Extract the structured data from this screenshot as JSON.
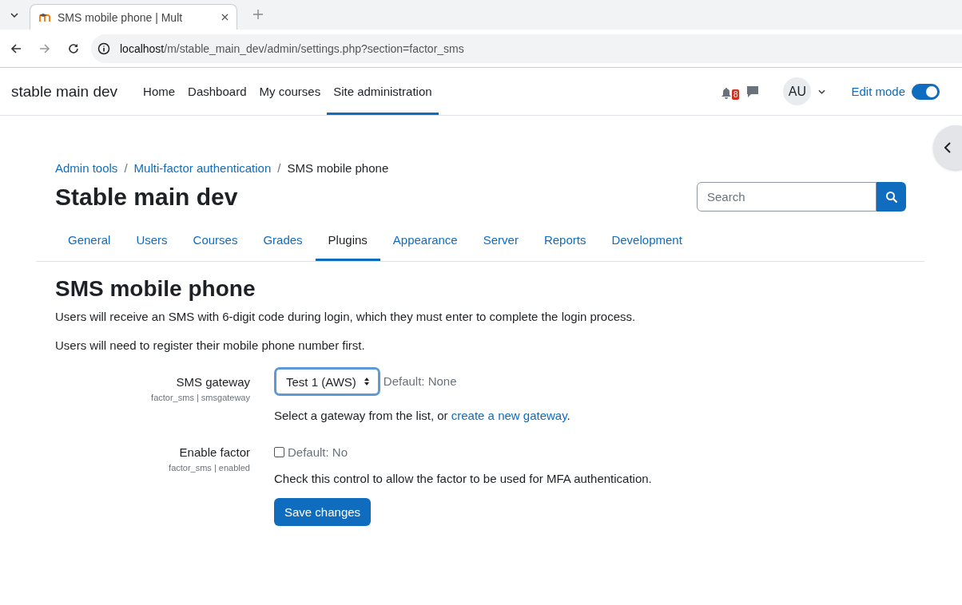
{
  "browser": {
    "tab_title": "SMS mobile phone | Mult",
    "url_host": "localhost",
    "url_path": "/m/stable_main_dev/admin/settings.php?section=factor_sms"
  },
  "navbar": {
    "site_name": "stable main dev",
    "items": [
      {
        "label": "Home",
        "selected": false
      },
      {
        "label": "Dashboard",
        "selected": false
      },
      {
        "label": "My courses",
        "selected": false
      },
      {
        "label": "Site administration",
        "selected": true
      }
    ],
    "notification_count": "8",
    "avatar": "AU",
    "edit_mode": {
      "label": "Edit mode",
      "on": true
    }
  },
  "breadcrumb": [
    {
      "label": "Admin tools",
      "link": true
    },
    {
      "separator": "/",
      "label": "Multi-factor authentication",
      "link": true
    },
    {
      "separator": "/",
      "label": "SMS mobile phone",
      "link": false
    }
  ],
  "page_title": "Stable main dev",
  "search": {
    "placeholder": "Search"
  },
  "tabs": [
    {
      "label": "General",
      "selected": false
    },
    {
      "label": "Users",
      "selected": false
    },
    {
      "label": "Courses",
      "selected": false
    },
    {
      "label": "Grades",
      "selected": false
    },
    {
      "label": "Plugins",
      "selected": true
    },
    {
      "label": "Appearance",
      "selected": false
    },
    {
      "label": "Server",
      "selected": false
    },
    {
      "label": "Reports",
      "selected": false
    },
    {
      "label": "Development",
      "selected": false
    }
  ],
  "section": {
    "heading": "SMS mobile phone",
    "paragraphs": [
      "Users will receive an SMS with 6-digit code during login, which they must enter to complete the login process.",
      "Users will need to register their mobile phone number first."
    ]
  },
  "settings": [
    {
      "kind": "select",
      "label": "SMS gateway",
      "key": "factor_sms | smsgateway",
      "value": "Test 1 (AWS)",
      "default": "Default: None",
      "description": {
        "before": "Select a gateway from the list, or ",
        "link": "create a new gateway",
        "after": "."
      }
    },
    {
      "kind": "checkbox",
      "label": "Enable factor",
      "key": "factor_sms | enabled",
      "checked": false,
      "default": "Default: No",
      "description": {
        "before": "Check this control to allow the factor to be used for MFA authentication."
      }
    }
  ],
  "save_button": "Save changes"
}
